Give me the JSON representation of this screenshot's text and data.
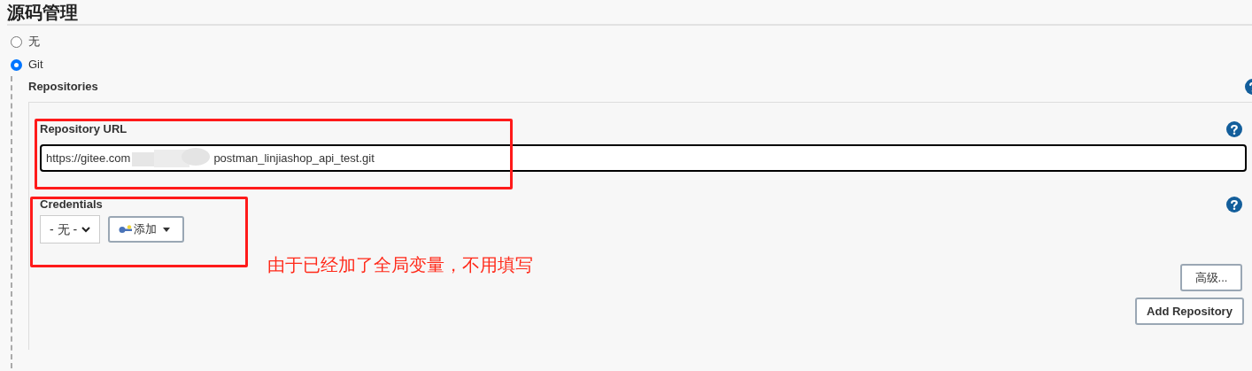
{
  "section": {
    "title": "源码管理"
  },
  "scm_options": [
    {
      "label": "无",
      "selected": false
    },
    {
      "label": "Git",
      "selected": true
    }
  ],
  "repositories": {
    "label": "Repositories",
    "url_label": "Repository URL",
    "url_start": "https://gitee.com",
    "url_end": "postman_linjiashop_api_test.git",
    "credentials_label": "Credentials",
    "credentials_select": "- 无 -",
    "add_button": "添加",
    "advanced_button": "高级...",
    "add_repository_button": "Add Repository"
  },
  "annotation": {
    "note": "由于已经加了全局变量，不用填写"
  }
}
